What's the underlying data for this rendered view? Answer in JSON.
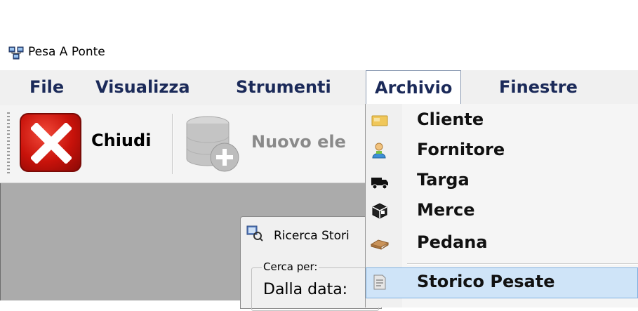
{
  "window": {
    "title": "Pesa A Ponte",
    "icon": "network-computers-icon"
  },
  "menubar": {
    "items": [
      {
        "label": "File"
      },
      {
        "label": "Visualizza"
      },
      {
        "label": "Strumenti"
      },
      {
        "label": "Archivio"
      },
      {
        "label": "Finestre"
      }
    ],
    "open_menu": "Archivio"
  },
  "toolbar": {
    "close_label": "Chiudi",
    "close_icon": "red-x-close-icon",
    "new_label": "Nuovo ele",
    "new_icon": "database-add-icon"
  },
  "child_window": {
    "title": "Ricerca Stori",
    "icon": "search-history-icon",
    "group_label": "Cerca per:",
    "from_date_label": "Dalla data:"
  },
  "archivio_menu": {
    "items": [
      {
        "label": "Cliente",
        "icon": "folder-card-icon"
      },
      {
        "label": "Fornitore",
        "icon": "person-icon"
      },
      {
        "label": "Targa",
        "icon": "truck-icon"
      },
      {
        "label": "Merce",
        "icon": "box-icon"
      },
      {
        "label": "Pedana",
        "icon": "pallet-icon"
      },
      {
        "label": "Storico Pesate",
        "icon": "document-list-icon",
        "highlighted": true
      }
    ]
  },
  "colors": {
    "menu_text": "#1b2a59",
    "highlight": "#cfe4f8",
    "workspace": "#ababab",
    "close_red": "#c8120a"
  }
}
